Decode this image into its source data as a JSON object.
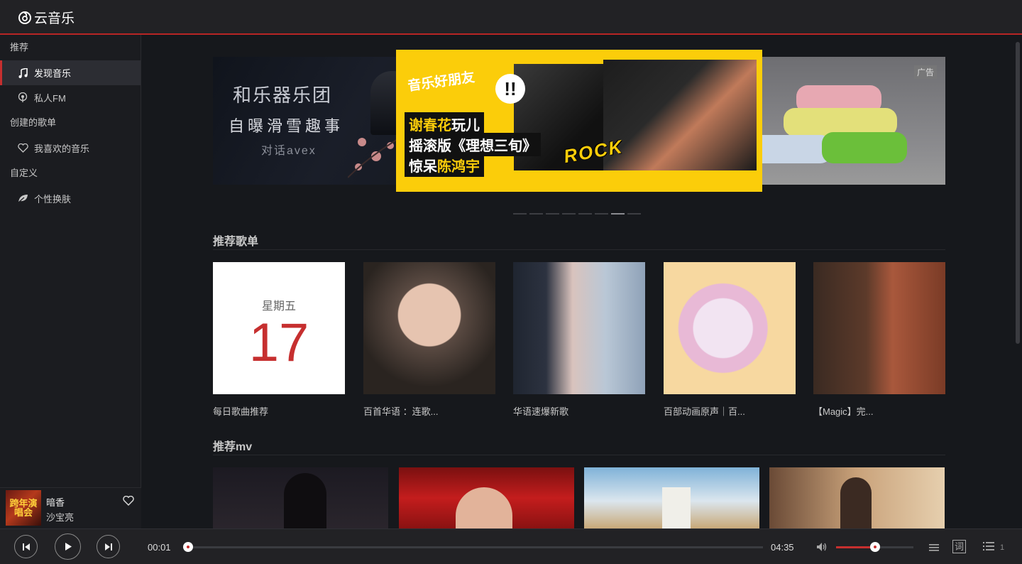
{
  "app": {
    "name": "云音乐"
  },
  "sidebar": {
    "groups": [
      {
        "title": "推荐",
        "items": [
          {
            "label": "发现音乐",
            "icon": "music-note-icon",
            "active": true
          },
          {
            "label": "私人FM",
            "icon": "radio-icon",
            "active": false
          }
        ]
      },
      {
        "title": "创建的歌单",
        "items": [
          {
            "label": "我喜欢的音乐",
            "icon": "heart-icon",
            "active": false
          }
        ]
      },
      {
        "title": "自定义",
        "items": [
          {
            "label": "个性换肤",
            "icon": "leaf-icon",
            "active": false
          }
        ]
      }
    ]
  },
  "now_playing": {
    "title": "暗香",
    "artist": "沙宝亮",
    "cover_text": "跨年演唱会"
  },
  "banner": {
    "left": {
      "line1": "和乐器乐团",
      "line2": "自曝滑雪趣事",
      "line3": "对话avex"
    },
    "center": {
      "headline": "音乐好朋友",
      "line1_a": "谢春花",
      "line1_b": "玩儿",
      "line2": "摇滚版《理想三旬》",
      "line3_a": "惊呆",
      "line3_b": "陈鸿宇",
      "tag": "ROCK",
      "exclaim": "!!"
    },
    "right": {
      "ad_label": "广告"
    },
    "dot_count": 8,
    "active_dot": 6
  },
  "sections": {
    "playlists_title": "推荐歌单",
    "mv_title": "推荐mv"
  },
  "playlists": [
    {
      "label": "每日歌曲推荐",
      "weekday": "星期五",
      "day": "17"
    },
    {
      "label": "百首华语 ：连歌..."
    },
    {
      "label": "华语速爆新歌"
    },
    {
      "label": "百部动画原声｜百..."
    },
    {
      "label": "【Magic】完..."
    }
  ],
  "player": {
    "current_time": "00:01",
    "total_time": "04:35",
    "progress_fraction": 0.004,
    "volume_fraction": 0.5,
    "queue_count": "1",
    "lyric_label": "词"
  },
  "colors": {
    "accent": "#c62f2f",
    "topbar": "#222225",
    "sidebar": "#1b1c20",
    "main": "#16181c"
  }
}
